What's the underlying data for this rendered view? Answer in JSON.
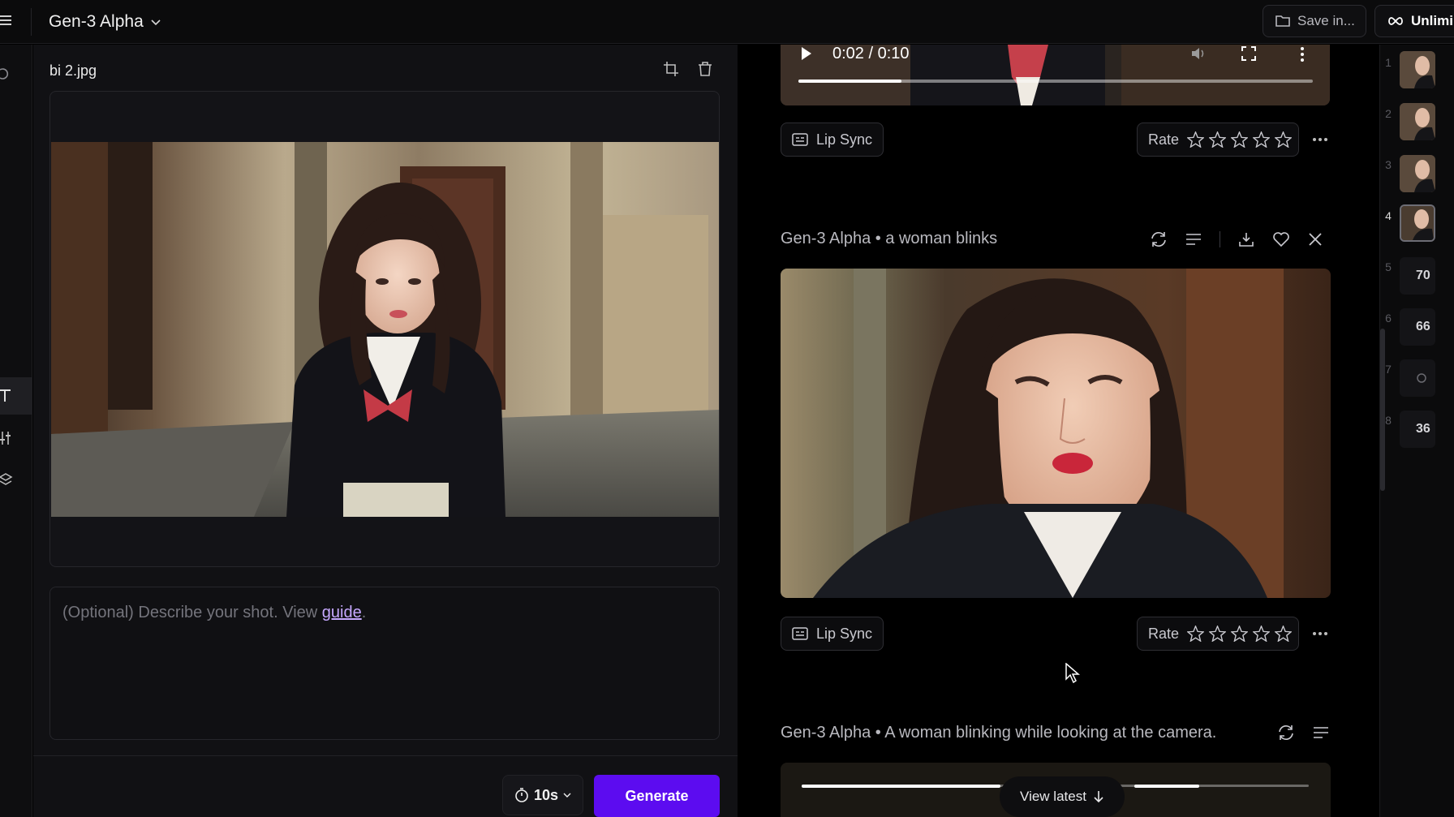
{
  "topbar": {
    "model_name": "Gen-3 Alpha",
    "save_label": "Save in...",
    "plan_label": "Unlimi"
  },
  "left_panel": {
    "file_name": "bi 2.jpg",
    "prompt_placeholder": "(Optional) Describe your shot. View ",
    "prompt_link": "guide",
    "prompt_suffix": ".",
    "duration_label": "10s",
    "generate_label": "Generate"
  },
  "feed": {
    "top_video": {
      "time": "0:02 / 0:10",
      "progress": 0.2
    },
    "lip_sync_label": "Lip Sync",
    "rate_label": "Rate",
    "generations": [
      {
        "title": "Gen-3 Alpha • a woman blinks"
      },
      {
        "title": "Gen-3 Alpha • A woman blinking while looking at the camera."
      }
    ],
    "view_latest_label": "View latest"
  },
  "history": {
    "items": [
      {
        "num": "1"
      },
      {
        "num": "2"
      },
      {
        "num": "3"
      },
      {
        "num": "4",
        "active": true
      },
      {
        "num": "5",
        "duration": "70"
      },
      {
        "num": "6",
        "duration": "66"
      },
      {
        "num": "7"
      },
      {
        "num": "8",
        "duration": "36"
      }
    ]
  },
  "colors": {
    "accent": "#5c0cf0",
    "link": "#c6a8ff",
    "panel_bg": "#111114"
  }
}
